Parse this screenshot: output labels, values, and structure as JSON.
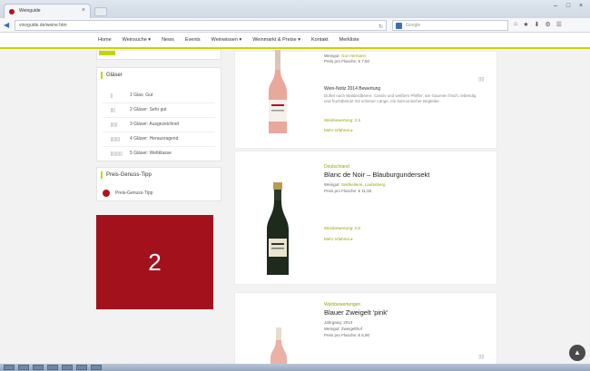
{
  "browser": {
    "tab_title": "Weinguide",
    "tab_close": "×",
    "url": "vinoguide.de/weine.htm",
    "search_placeholder": "Google",
    "window_min": "–",
    "window_max": "□",
    "window_close": "×",
    "back_glyph": "◀",
    "toolbar_glyphs": [
      "⌂",
      "★",
      "⬇",
      "⚙",
      "☰"
    ]
  },
  "nav": {
    "items": [
      "Home",
      "Weinsuche ▾",
      "News",
      "Events",
      "Weinwissen ▾",
      "Weinmarkt & Preise ▾",
      "Kontakt",
      "Merkliste"
    ]
  },
  "sidebar": {
    "glas_title": "Gläser",
    "glas_items": [
      {
        "icon": "▯",
        "label": "1 Glas: Gut"
      },
      {
        "icon": "▯▯",
        "label": "2 Gläser: Sehr gut"
      },
      {
        "icon": "▯▯▯",
        "label": "3 Gläser: Ausgezeichnet"
      },
      {
        "icon": "▯▯▯▯",
        "label": "4 Gläser: Herausragend"
      },
      {
        "icon": "▯▯▯▯▯",
        "label": "5 Gläser: Weltklasse"
      }
    ],
    "pg_title": "Preis-Genuss-Tipp",
    "pg_label": "Preis-Genuss-Tipp",
    "ad_number": "2"
  },
  "products": [
    {
      "category": "",
      "name": "",
      "weingut_label": "Weingut:",
      "weingut": "Gut Hermann",
      "price": "Preis pro Flasche: € 7,50",
      "desc_title": "Wein-Notiz 2014 Bewertung",
      "desc": "Duftet nach Walderdbeere, Cassis und weißem Pfeffer; am Gaumen frisch, lebendig und fruchtbetont mit schöner Länge, ein harmonischer Begleiter.",
      "rating_link": "Weinbewertung: 2,5",
      "more_link": "Mehr erfahren ▸",
      "glass_icon": "▯▯"
    },
    {
      "category": "Deutschland",
      "name": "Blanc de Noir – Blauburgundersekt",
      "weingut_label": "Weingut:",
      "weingut": "Sektkellerei, Laufenberg",
      "price": "Preis pro Flasche: € 11,50",
      "rating_link": "Weinbewertung: 2,5",
      "more_link": "Mehr erfahren ▸"
    },
    {
      "category": "Weinbewertungen",
      "name": "Blauer Zweigelt 'pink'",
      "vintage": "Jahrgang: 2013",
      "weingut": "Weingut: Zweigelthof",
      "price": "Preis pro Flasche: € 6,90",
      "glass_icon": "▯▯"
    }
  ],
  "colors": {
    "accent": "#c8d400",
    "brand_red": "#a3121c"
  },
  "scroll_top_glyph": "▲"
}
